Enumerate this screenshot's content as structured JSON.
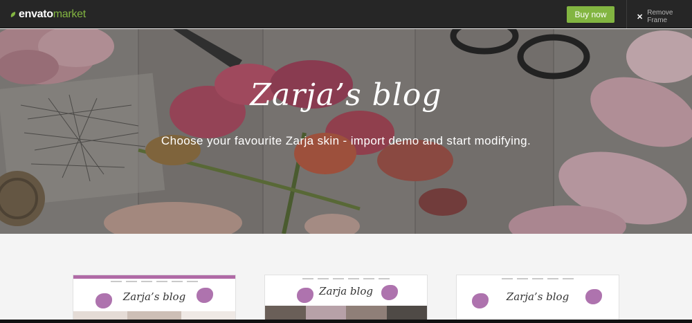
{
  "topbar": {
    "logo_brand": "envato",
    "logo_market": "market",
    "buy_label": "Buy now",
    "remove_label": "Remove Frame",
    "remove_icon": "close-icon",
    "accent": "#82b541"
  },
  "hero": {
    "title": "Zarja’s blog",
    "subtitle": "Choose your favourite Zarja skin - import demo and start modifying."
  },
  "cards": [
    {
      "title": "Zarja’s blog",
      "accent": "#b06aa6"
    },
    {
      "title": "Zarja blog",
      "accent": "#a05aa0"
    },
    {
      "title": "Zarja’s blog",
      "accent": "#a05aa0"
    }
  ]
}
